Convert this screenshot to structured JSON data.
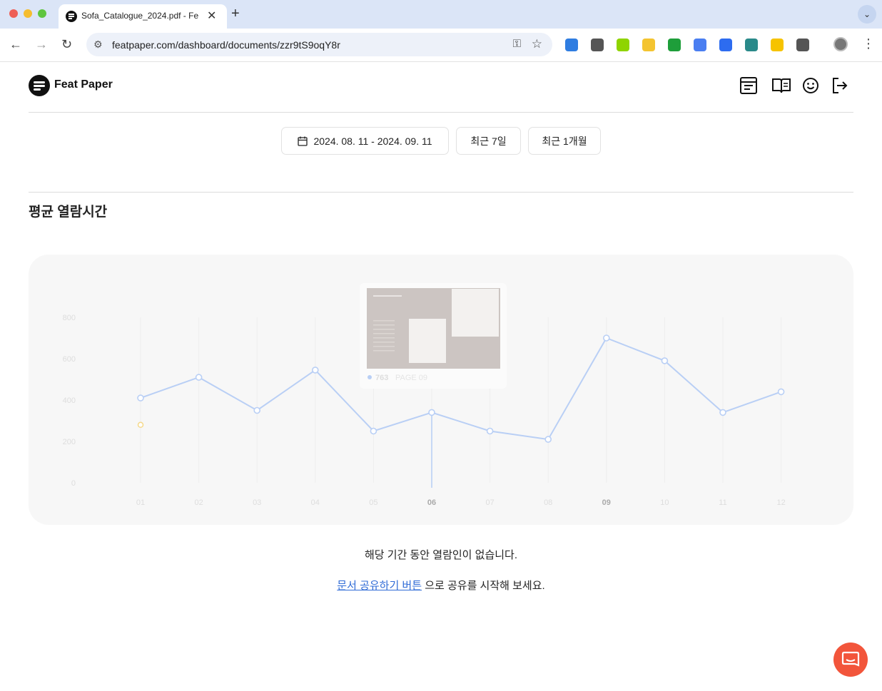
{
  "browser": {
    "tab_title": "Sofa_Catalogue_2024.pdf - Fe",
    "url": "featpaper.com/dashboard/documents/zzr9tS9oqY8r"
  },
  "extensions": [
    {
      "name": "extension-triangle-icon",
      "color": "#2f7de1"
    },
    {
      "name": "extension-cloud-icon",
      "color": "#555555"
    },
    {
      "name": "extension-green-icon",
      "color": "#8fd400"
    },
    {
      "name": "extension-r-icon",
      "color": "#f4c430"
    },
    {
      "name": "extension-check-icon",
      "color": "#1e9e3a"
    },
    {
      "name": "extension-translate-icon",
      "color": "#4a7ef1"
    },
    {
      "name": "extension-zoom-icon",
      "color": "#2d6cf0"
    },
    {
      "name": "extension-teal-icon",
      "color": "#2a8a8a"
    },
    {
      "name": "extension-bulb-icon",
      "color": "#f6c300"
    },
    {
      "name": "extension-puzzle-icon",
      "color": "#555555"
    }
  ],
  "header": {
    "brand": "Feat Paper"
  },
  "filters": {
    "date_range": "2024. 08. 11 - 2024. 09. 11",
    "last7": "최근 7일",
    "last_month": "최근 1개월"
  },
  "section": {
    "title": "평균 열람시간"
  },
  "chart_data": {
    "type": "line",
    "categories": [
      "01",
      "02",
      "03",
      "04",
      "05",
      "06",
      "07",
      "08",
      "09",
      "10",
      "11",
      "12"
    ],
    "y_ticks": [
      "800",
      "600",
      "400",
      "200",
      "0"
    ],
    "ylim": [
      0,
      800
    ],
    "series": [
      {
        "values": [
          410,
          510,
          350,
          545,
          250,
          340,
          250,
          210,
          700,
          590,
          340,
          440
        ],
        "color": "#b9cff5"
      }
    ],
    "secondary_marker": {
      "category": "01",
      "value": 280,
      "color": "#f5d98b"
    },
    "highlight_categories": [
      "06",
      "09"
    ],
    "tooltip": {
      "category": "06",
      "value": "763",
      "label": "PAGE 09"
    }
  },
  "empty": {
    "message": "해당 기간 동안 열람인이 없습니다.",
    "link": "문서 공유하기 버튼",
    "suffix": " 으로 공유를 시작해 보세요."
  }
}
